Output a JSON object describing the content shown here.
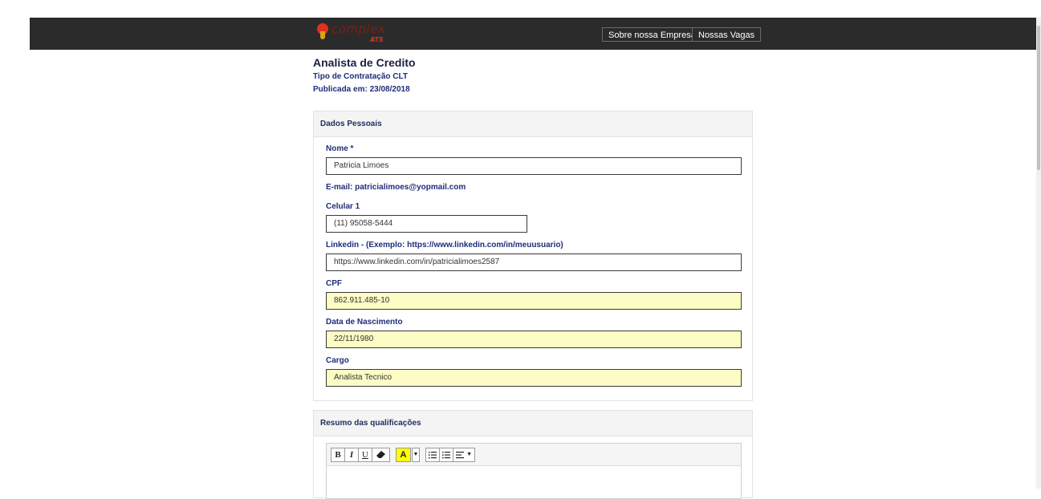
{
  "header": {
    "logo_text": "complex",
    "logo_sub": "ATS",
    "nav": {
      "about": "Sobre nossa Empresa",
      "jobs": "Nossas Vagas"
    }
  },
  "job": {
    "title": "Analista de Credito",
    "contract": "Tipo de Contratação CLT",
    "published": "Publicada em: 23/08/2018"
  },
  "personal": {
    "section_title": "Dados Pessoais",
    "name_label": "Nome *",
    "name_value": "Patricia Limoes",
    "email_label": "E-mail: patricialimoes@yopmail.com",
    "phone_label": "Celular 1",
    "phone_value": "(11) 95058-5444",
    "linkedin_label": "Linkedin - (Exemplo: https://www.linkedin.com/in/meuusuario)",
    "linkedin_value": "https://www.linkedin.com/in/patricialimoes2587",
    "cpf_label": "CPF",
    "cpf_value": "862.911.485-10",
    "birth_label": "Data de Nascimento",
    "birth_value": "22/11/1980",
    "role_label": "Cargo",
    "role_value": "Analista Tecnico"
  },
  "summary": {
    "section_title": "Resumo das qualificações",
    "toolbar": {
      "bold": "B",
      "italic": "I",
      "underline": "U",
      "highlight": "A"
    }
  }
}
